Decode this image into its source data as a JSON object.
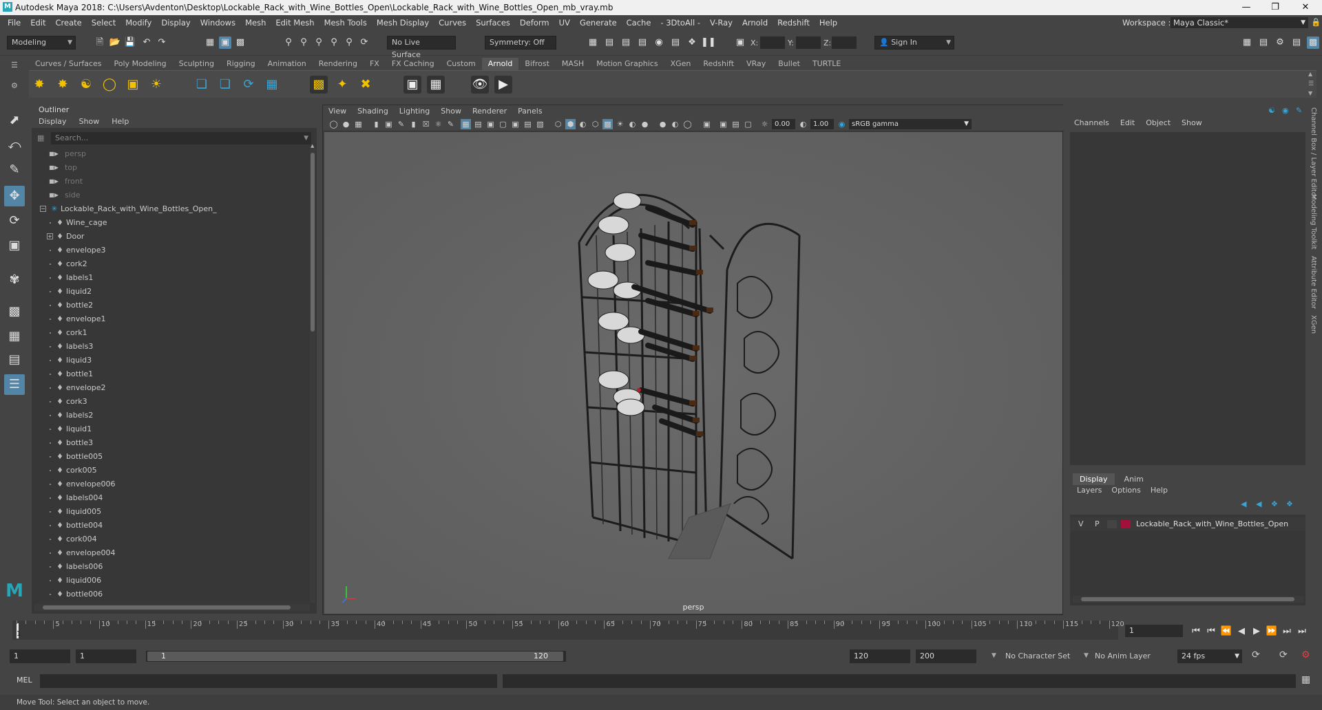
{
  "window": {
    "title": "Autodesk Maya 2018: C:\\Users\\Avdenton\\Desktop\\Lockable_Rack_with_Wine_Bottles_Open\\Lockable_Rack_with_Wine_Bottles_Open_mb_vray.mb",
    "logo_letter": "M"
  },
  "menubar": {
    "items": [
      "File",
      "Edit",
      "Create",
      "Select",
      "Modify",
      "Display",
      "Windows",
      "Mesh",
      "Edit Mesh",
      "Mesh Tools",
      "Mesh Display",
      "Curves",
      "Surfaces",
      "Deform",
      "UV",
      "Generate",
      "Cache",
      "- 3DtoAll -",
      "V-Ray",
      "Arnold",
      "Redshift",
      "Help"
    ],
    "workspace_label": "Workspace :",
    "workspace_value": "Maya Classic*"
  },
  "statusline": {
    "mode": "Modeling",
    "live_surface": "No Live Surface",
    "symmetry": "Symmetry: Off",
    "x_label": "X:",
    "y_label": "Y:",
    "z_label": "Z:",
    "sign_in": "Sign In"
  },
  "shelf": {
    "tabs": [
      "Curves / Surfaces",
      "Poly Modeling",
      "Sculpting",
      "Rigging",
      "Animation",
      "Rendering",
      "FX",
      "FX Caching",
      "Custom",
      "Arnold",
      "Bifrost",
      "MASH",
      "Motion Graphics",
      "XGen",
      "Redshift",
      "VRay",
      "Bullet",
      "TURTLE"
    ],
    "active_tab": "Arnold"
  },
  "outliner": {
    "title": "Outliner",
    "menu": [
      "Display",
      "Show",
      "Help"
    ],
    "search_placeholder": "Search...",
    "cameras": [
      "persp",
      "top",
      "front",
      "side"
    ],
    "root": "Lockable_Rack_with_Wine_Bottles_Open_",
    "children": [
      "Wine_cage",
      "Door",
      "envelope3",
      "cork2",
      "labels1",
      "liquid2",
      "bottle2",
      "envelope1",
      "cork1",
      "labels3",
      "liquid3",
      "bottle1",
      "envelope2",
      "cork3",
      "labels2",
      "liquid1",
      "bottle3",
      "bottle005",
      "cork005",
      "envelope006",
      "labels004",
      "liquid005",
      "bottle004",
      "cork004",
      "envelope004",
      "labels006",
      "liquid006",
      "bottle006"
    ]
  },
  "viewport": {
    "menu": [
      "View",
      "Shading",
      "Lighting",
      "Show",
      "Renderer",
      "Panels"
    ],
    "exposure": "0.00",
    "gamma": "1.00",
    "colorspace": "sRGB gamma",
    "camera_label": "persp"
  },
  "channelbox": {
    "menu": [
      "Channels",
      "Edit",
      "Object",
      "Show"
    ]
  },
  "layers": {
    "tabs": [
      "Display",
      "Anim"
    ],
    "active_tab": "Display",
    "menu": [
      "Layers",
      "Options",
      "Help"
    ],
    "rows": [
      {
        "v": "V",
        "p": "P",
        "name": "Lockable_Rack_with_Wine_Bottles_Open",
        "color": "#a3103a"
      }
    ]
  },
  "sidetabs": [
    "Channel Box / Layer Editor",
    "Modeling Toolkit",
    "Attribute Editor",
    "XGen"
  ],
  "timeline": {
    "ticks": [
      "5",
      "10",
      "15",
      "20",
      "25",
      "30",
      "35",
      "40",
      "45",
      "50",
      "55",
      "60",
      "65",
      "70",
      "75",
      "80",
      "85",
      "90",
      "95",
      "100",
      "105",
      "110",
      "115",
      "120"
    ],
    "first_label": "1",
    "current_frame": "1"
  },
  "range": {
    "start": "1",
    "anim_start": "1",
    "range_start": "1",
    "range_end": "120",
    "anim_end_field": "120",
    "end_field": "200",
    "character_set": "No Character Set",
    "anim_layer": "No Anim Layer",
    "fps": "24 fps"
  },
  "commandline": {
    "mel_label": "MEL"
  },
  "helpline": {
    "text": "Move Tool: Select an object to move."
  }
}
